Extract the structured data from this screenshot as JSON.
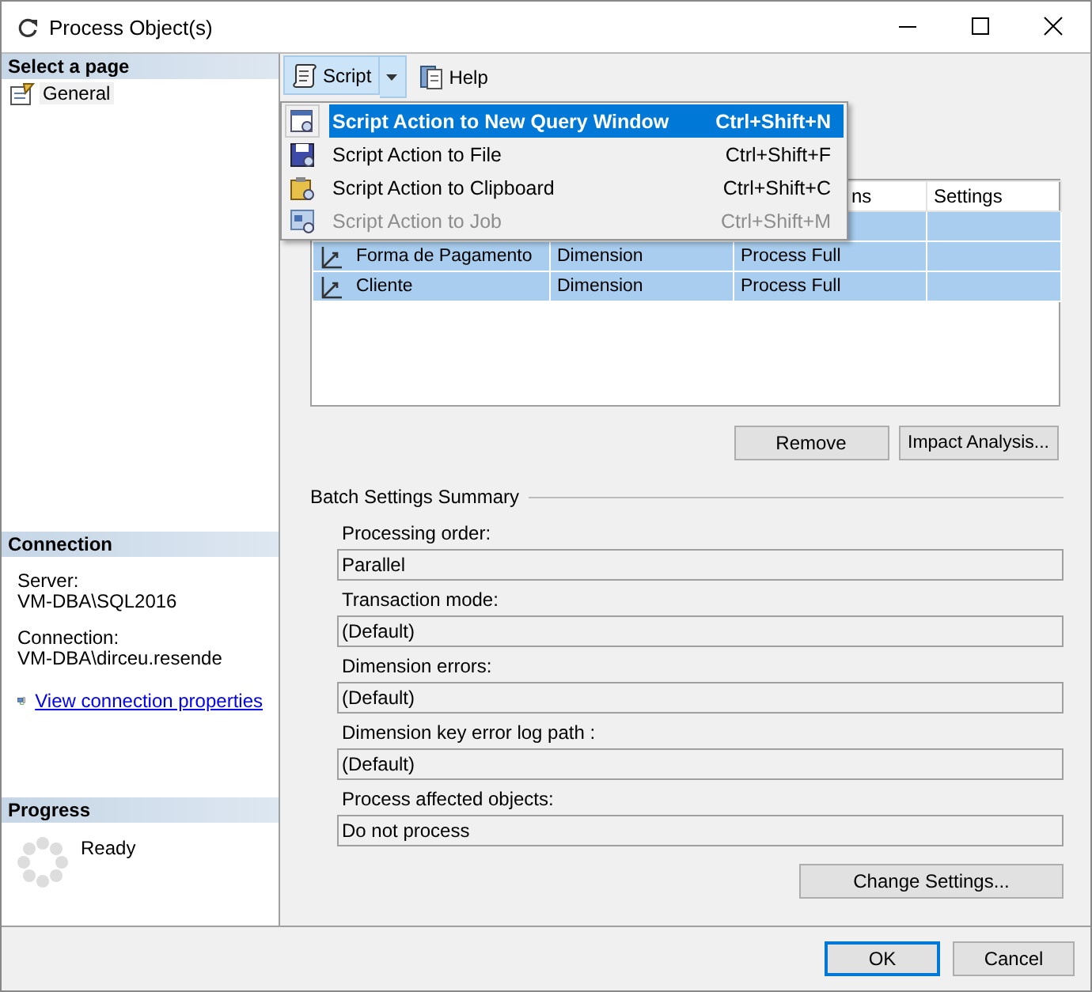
{
  "window": {
    "title": "Process Object(s)"
  },
  "sidebar": {
    "header": "Select a page",
    "pages": [
      {
        "label": "General",
        "selected": true
      }
    ]
  },
  "connection": {
    "header": "Connection",
    "server_label": "Server:",
    "server": "VM-DBA\\SQL2016",
    "connection_label": "Connection:",
    "connection": "VM-DBA\\dirceu.resende",
    "link": "View connection properties"
  },
  "progress": {
    "header": "Progress",
    "status": "Ready"
  },
  "toolbar": {
    "buttons": [
      {
        "label": "Script",
        "kind": "split",
        "pressed": true
      },
      {
        "label": "Help",
        "kind": "plain",
        "pressed": false
      }
    ]
  },
  "script_menu": {
    "items": [
      {
        "label": "Script Action to New Query Window",
        "shortcut": "Ctrl+Shift+N",
        "selected": true,
        "disabled": false,
        "kind": "query"
      },
      {
        "label": "Script Action to File",
        "shortcut": "Ctrl+Shift+F",
        "selected": false,
        "disabled": false,
        "kind": "file"
      },
      {
        "label": "Script Action to Clipboard",
        "shortcut": "Ctrl+Shift+C",
        "selected": false,
        "disabled": false,
        "kind": "clipboard"
      },
      {
        "label": "Script Action to Job",
        "shortcut": "Ctrl+Shift+M",
        "selected": false,
        "disabled": true,
        "kind": "job"
      }
    ]
  },
  "objects_grid": {
    "columns": {
      "column_3": "ns",
      "column_4": "Settings"
    },
    "rows": [
      {
        "selected": true
      },
      {
        "name": "Forma de Pagamento",
        "type": "Dimension",
        "options": "Process Full",
        "selected": true
      },
      {
        "name": "Cliente",
        "type": "Dimension",
        "options": "Process Full",
        "selected": true
      }
    ]
  },
  "grid_buttons": [
    "Remove",
    "Impact Analysis..."
  ],
  "batch_settings": {
    "title": "Batch Settings Summary",
    "fields": [
      {
        "label": "Processing order:",
        "value": "Parallel"
      },
      {
        "label": "Transaction mode:",
        "value": "(Default)"
      },
      {
        "label": "Dimension errors:",
        "value": "(Default)"
      },
      {
        "label": "Dimension key error log path :",
        "value": "(Default)"
      },
      {
        "label": "Process affected objects:",
        "value": "Do not process"
      }
    ],
    "button": "Change Settings..."
  },
  "dialog_buttons": [
    {
      "label": "OK",
      "default": true
    },
    {
      "label": "Cancel",
      "default": false
    }
  ]
}
